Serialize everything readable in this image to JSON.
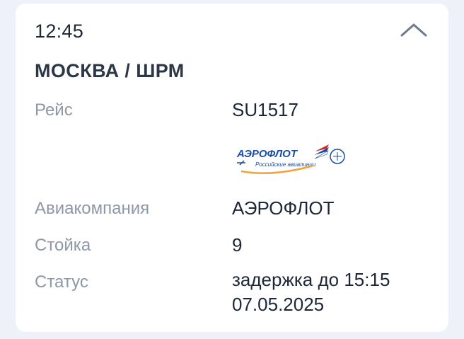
{
  "flight_card": {
    "time": "12:45",
    "route": "МОСКВА / ШРМ",
    "rows": {
      "flight_label": "Рейс",
      "flight_value": "SU1517",
      "airline_label": "Авиакомпания",
      "airline_value": "АЭРОФЛОТ",
      "counter_label": "Стойка",
      "counter_value": "9",
      "status_label": "Статус",
      "status_value": "задержка до 15:15 07.05.2025"
    },
    "logo": {
      "wordmark": "АЭРОФЛОТ",
      "tagline": "Российские авиалинии",
      "icon": "aeroflot-logo-icon"
    },
    "collapse_icon": "chevron-up-icon"
  },
  "colors": {
    "background": "#eef2f8",
    "card": "#ffffff",
    "text_primary": "#1d2738",
    "text_label": "#8e97a6",
    "logo_blue": "#1a4ea0",
    "logo_orange": "#f2a23c",
    "logo_red": "#d22c2c"
  }
}
